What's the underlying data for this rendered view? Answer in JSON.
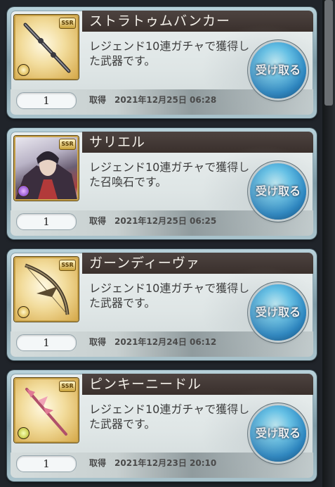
{
  "items": [
    {
      "name": "ストラトゥムバンカー",
      "description": "レジェンド10連ガチャで獲得した武器です。",
      "quantity": "1",
      "acquired_label": "取得",
      "date": "2021年12月25日 06:28",
      "button_label": "受け取る",
      "rarity": "SSR",
      "element": "light",
      "thumb_icon": "weapon-staff-icon"
    },
    {
      "name": "サリエル",
      "description": "レジェンド10連ガチャで獲得した召喚石です。",
      "quantity": "1",
      "acquired_label": "取得",
      "date": "2021年12月25日 06:25",
      "button_label": "受け取る",
      "rarity": "SSR",
      "element": "dark",
      "thumb_icon": "summon-portrait-icon"
    },
    {
      "name": "ガーンディーヴァ",
      "description": "レジェンド10連ガチャで獲得した武器です。",
      "quantity": "1",
      "acquired_label": "取得",
      "date": "2021年12月24日 06:12",
      "button_label": "受け取る",
      "rarity": "SSR",
      "element": "light",
      "thumb_icon": "weapon-bow-icon"
    },
    {
      "name": "ピンキーニードル",
      "description": "レジェンド10連ガチャで獲得した武器です。",
      "quantity": "1",
      "acquired_label": "取得",
      "date": "2021年12月23日 20:10",
      "button_label": "受け取る",
      "rarity": "SSR",
      "element": "wind",
      "thumb_icon": "weapon-spear-icon"
    }
  ],
  "colors": {
    "title_bar": "#3f3531",
    "button": "#2a8fd0"
  }
}
